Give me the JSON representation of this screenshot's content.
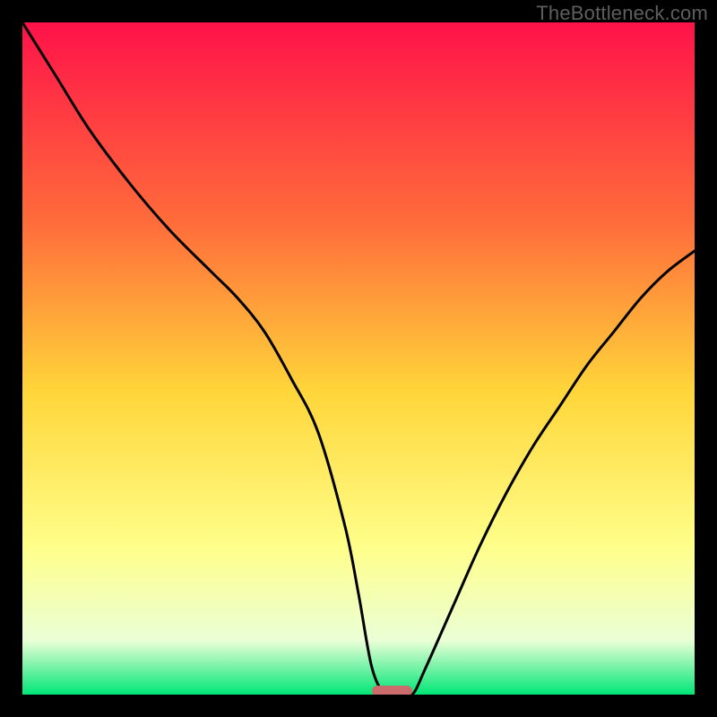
{
  "watermark": "TheBottleneck.com",
  "colors": {
    "frame": "#000000",
    "gradient_top": "#ff1249",
    "gradient_mid1": "#ff6d3a",
    "gradient_mid2": "#ffd63a",
    "gradient_mid3": "#ffff8a",
    "gradient_mid4": "#eaffd6",
    "gradient_bottom": "#00e676",
    "curve": "#000000",
    "marker": "#cc6b6b"
  },
  "chart_data": {
    "type": "line",
    "title": "",
    "xlabel": "",
    "ylabel": "",
    "xlim": [
      0,
      100
    ],
    "ylim": [
      0,
      100
    ],
    "grid": false,
    "series": [
      {
        "name": "bottleneck-curve",
        "x": [
          0,
          5,
          10,
          16,
          22,
          28,
          32,
          36,
          40,
          44,
          48,
          50,
          52,
          54,
          56,
          58,
          60,
          64,
          68,
          72,
          76,
          80,
          84,
          88,
          92,
          96,
          100
        ],
        "values": [
          100,
          92,
          84,
          76,
          69,
          63,
          59,
          54,
          47,
          39,
          25,
          15,
          4,
          0,
          0,
          0,
          4,
          13,
          22,
          30,
          37,
          43,
          49,
          54,
          59,
          63,
          66
        ]
      }
    ],
    "annotations": [
      {
        "name": "optimum-marker",
        "x_start": 52,
        "x_end": 58,
        "y": 0
      }
    ]
  }
}
